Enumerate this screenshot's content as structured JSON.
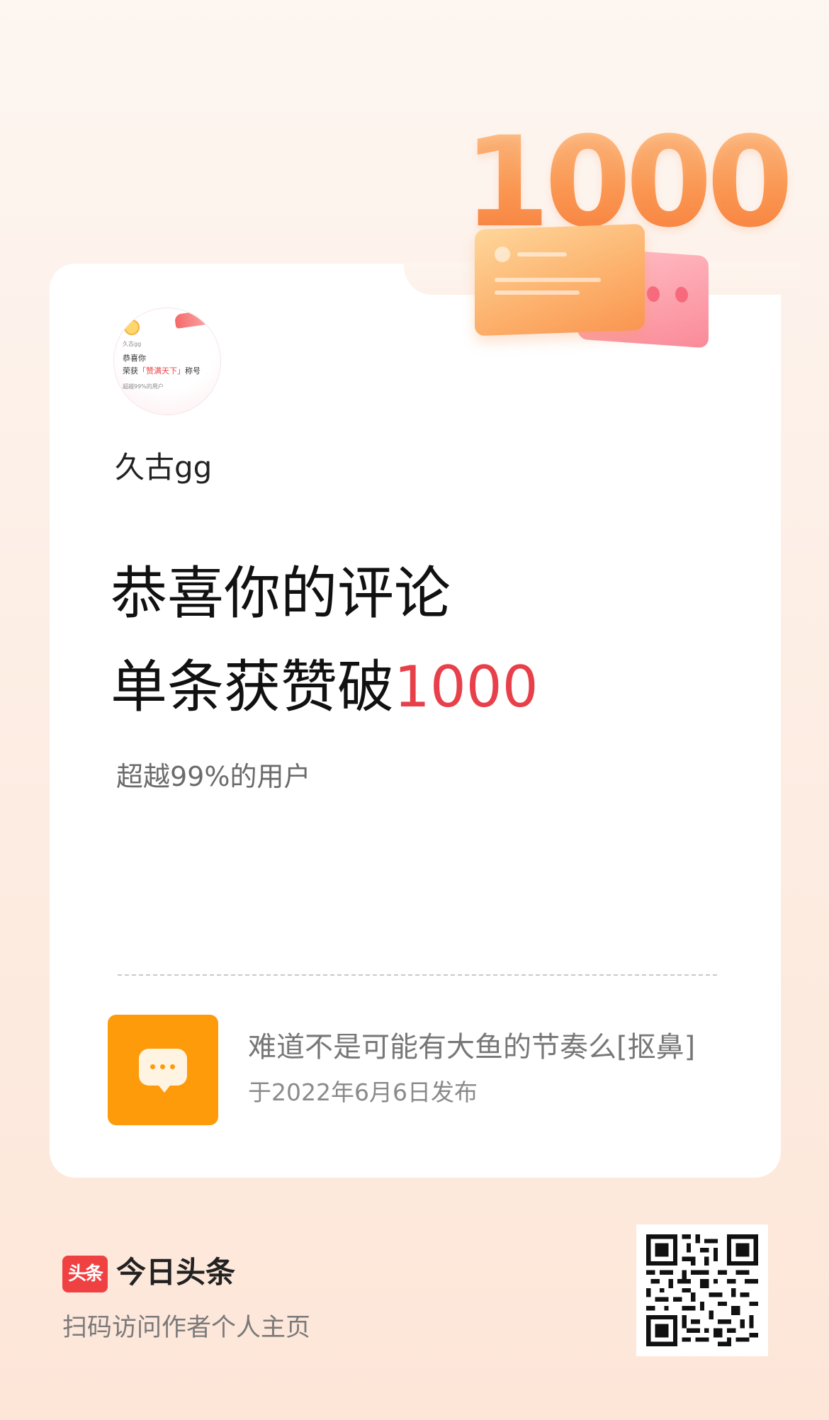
{
  "badge": {
    "small_name": "久古gg",
    "line1": "恭喜你",
    "line2_prefix": "荣获",
    "line2_title": "「赞满天下」",
    "line2_suffix": "称号",
    "line3": "超越99%的用户"
  },
  "user": {
    "name": "久古gg"
  },
  "achievement": {
    "line1": "恭喜你的评论",
    "line2_prefix": "单条获赞破",
    "count": "1000",
    "subtitle": "超越99%的用户"
  },
  "hero": {
    "digits": "1000"
  },
  "comment": {
    "text": "难道不是可能有大鱼的节奏么[抠鼻]",
    "date": "于2022年6月6日发布",
    "icon": "chat-bubble-icon"
  },
  "footer": {
    "logo_text": "头条",
    "app_name": "今日头条",
    "tip": "扫码访问作者个人主页"
  },
  "colors": {
    "accent_red": "#e8404a",
    "comment_icon_bg": "#fd9b0b",
    "logo_red": "#f04142"
  }
}
